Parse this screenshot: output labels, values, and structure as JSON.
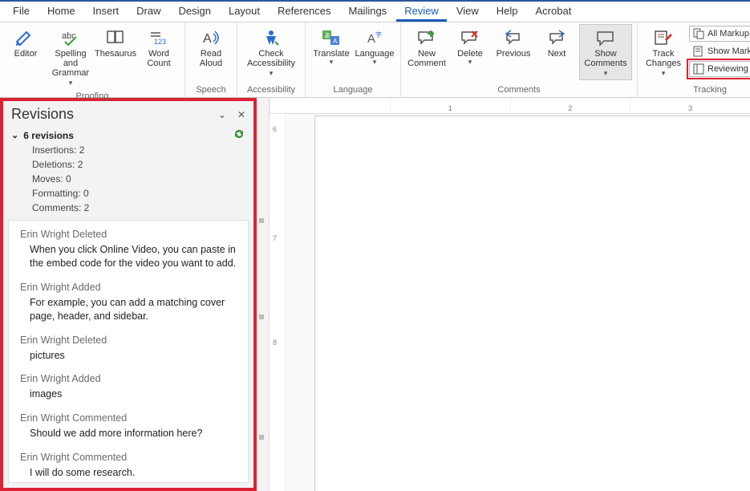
{
  "tabs": [
    "File",
    "Home",
    "Insert",
    "Draw",
    "Design",
    "Layout",
    "References",
    "Mailings",
    "Review",
    "View",
    "Help",
    "Acrobat"
  ],
  "activeTab": "Review",
  "ribbon": {
    "proofing": {
      "label": "Proofing",
      "editor": "Editor",
      "spelling_l1": "Spelling and",
      "spelling_l2": "Grammar",
      "thesaurus": "Thesaurus",
      "wordcount_l1": "Word",
      "wordcount_l2": "Count"
    },
    "speech": {
      "label": "Speech",
      "read_l1": "Read",
      "read_l2": "Aloud"
    },
    "accessibility": {
      "label": "Accessibility",
      "check_l1": "Check",
      "check_l2": "Accessibility"
    },
    "language": {
      "label": "Language",
      "translate": "Translate",
      "language": "Language"
    },
    "comments": {
      "label": "Comments",
      "new_l1": "New",
      "new_l2": "Comment",
      "delete": "Delete",
      "previous": "Previous",
      "next": "Next",
      "show_l1": "Show",
      "show_l2": "Comments"
    },
    "tracking": {
      "label": "Tracking",
      "track_l1": "Track",
      "track_l2": "Changes",
      "display_mode": "All Markup",
      "show_markup": "Show Markup",
      "reviewing_pane": "Reviewing Pane"
    }
  },
  "revisions": {
    "title": "Revisions",
    "count_label": "6 revisions",
    "stats": {
      "insertions": "Insertions: 2",
      "deletions": "Deletions: 2",
      "moves": "Moves: 0",
      "formatting": "Formatting: 0",
      "comments": "Comments: 2"
    },
    "items": [
      {
        "meta": "Erin Wright Deleted",
        "text": "When you click Online Video, you can paste in the embed code for the video you want to add."
      },
      {
        "meta": "Erin Wright Added",
        "text": "For example, you can add a matching cover page, header, and sidebar."
      },
      {
        "meta": "Erin Wright Deleted",
        "text": "pictures"
      },
      {
        "meta": "Erin Wright Added",
        "text": "images"
      },
      {
        "meta": "Erin Wright Commented",
        "text": "Should we add more information here?"
      },
      {
        "meta": "Erin Wright Commented",
        "text": "I will do some research."
      }
    ]
  },
  "ruler": {
    "numbers": [
      "",
      "1",
      "2",
      "3"
    ]
  },
  "vruler": {
    "numbers": [
      "6",
      "7",
      "8"
    ]
  }
}
